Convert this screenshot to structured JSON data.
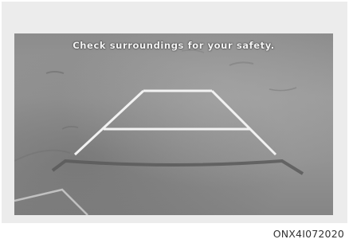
{
  "camera": {
    "warning_message": "Check surroundings for your safety."
  },
  "guidelines": {
    "line_color": "#f2f2f2",
    "curve_color": "#5a5a5a"
  },
  "figure": {
    "code": "ONX4I072020"
  }
}
